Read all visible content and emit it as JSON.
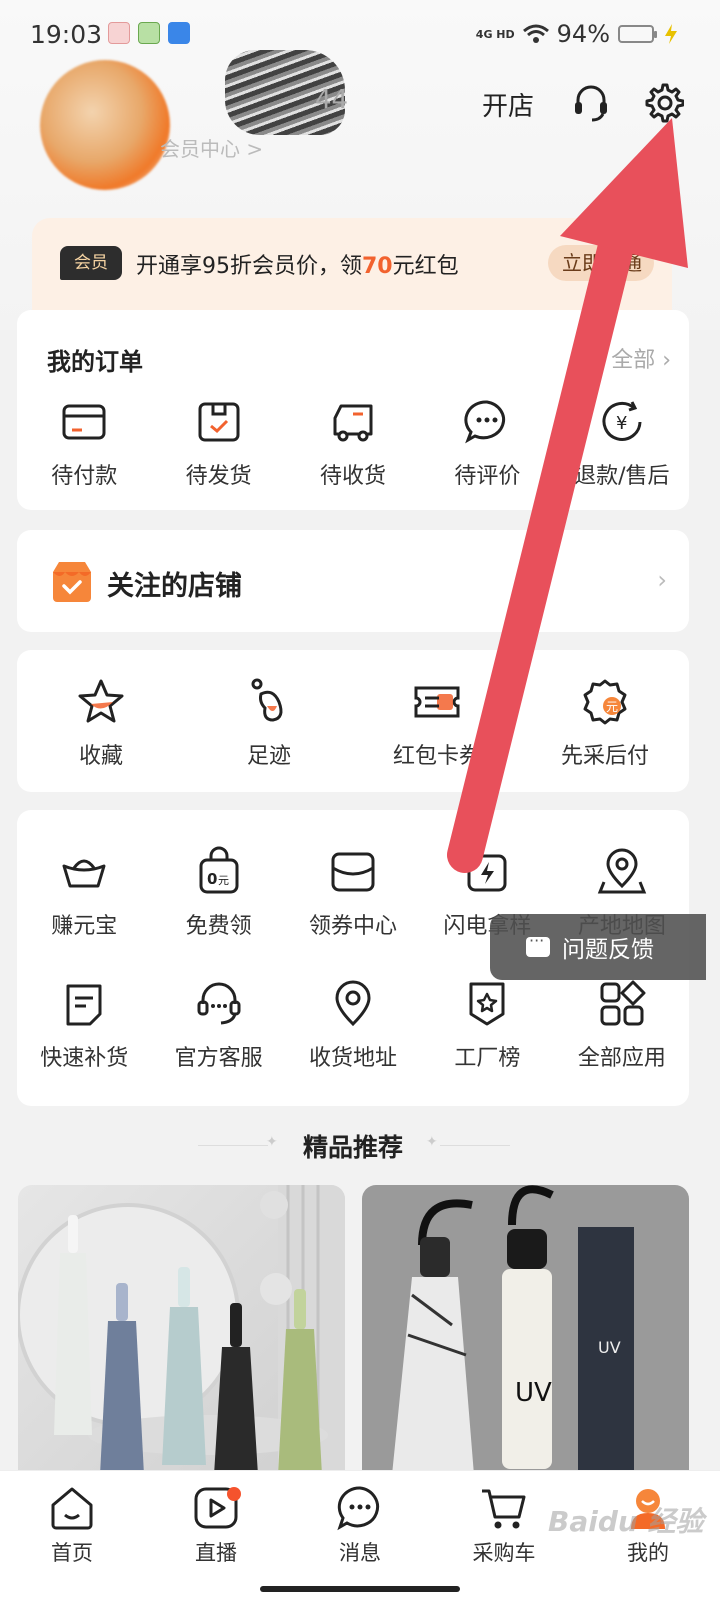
{
  "status_bar": {
    "time": "19:03",
    "network": "4G HD",
    "battery": "94%"
  },
  "profile": {
    "name_tail": "44",
    "sub_link": "会员中心 >"
  },
  "header": {
    "open_store": "开店"
  },
  "vip": {
    "badge": "会员",
    "text_before": "开通享95折会员价，领",
    "highlight": "70",
    "text_after": "元红包",
    "button": "立即开通"
  },
  "orders": {
    "title": "我的订单",
    "more": "全部 ›",
    "items": [
      {
        "label": "待付款",
        "icon": "wallet-icon"
      },
      {
        "label": "待发货",
        "icon": "package-icon"
      },
      {
        "label": "待收货",
        "icon": "truck-icon"
      },
      {
        "label": "待评价",
        "icon": "comment-icon"
      },
      {
        "label": "退款/售后",
        "icon": "refund-icon"
      }
    ]
  },
  "shops": {
    "title": "关注的店铺",
    "chevron": "›"
  },
  "quick": {
    "items": [
      {
        "label": "收藏",
        "icon": "star-icon"
      },
      {
        "label": "足迹",
        "icon": "footprint-icon"
      },
      {
        "label": "红包卡券",
        "icon": "coupon-icon"
      },
      {
        "label": "先采后付",
        "icon": "pay-later-icon"
      }
    ]
  },
  "services": {
    "row1": [
      {
        "label": "赚元宝",
        "icon": "ingot-icon"
      },
      {
        "label": "免费领",
        "icon": "free-bag-icon"
      },
      {
        "label": "领券中心",
        "icon": "coupon-center-icon"
      },
      {
        "label": "闪电拿样",
        "icon": "lightning-sample-icon"
      },
      {
        "label": "产地地图",
        "icon": "map-pin-icon"
      }
    ],
    "row2": [
      {
        "label": "快速补货",
        "icon": "restock-icon"
      },
      {
        "label": "官方客服",
        "icon": "support-icon"
      },
      {
        "label": "收货地址",
        "icon": "location-icon"
      },
      {
        "label": "工厂榜",
        "icon": "factory-rank-icon"
      },
      {
        "label": "全部应用",
        "icon": "apps-icon"
      }
    ]
  },
  "feedback": {
    "label": "问题反馈"
  },
  "recommend": {
    "title": "精品推荐"
  },
  "tabbar": [
    {
      "label": "首页",
      "icon": "home-icon"
    },
    {
      "label": "直播",
      "icon": "live-icon"
    },
    {
      "label": "消息",
      "icon": "message-icon"
    },
    {
      "label": "采购车",
      "icon": "cart-icon"
    },
    {
      "label": "我的",
      "icon": "profile-icon"
    }
  ],
  "colors": {
    "accent": "#f2622e",
    "arrow": "#e8505b",
    "live_dot": "#f5532d"
  },
  "watermark": "Baidu 经验"
}
